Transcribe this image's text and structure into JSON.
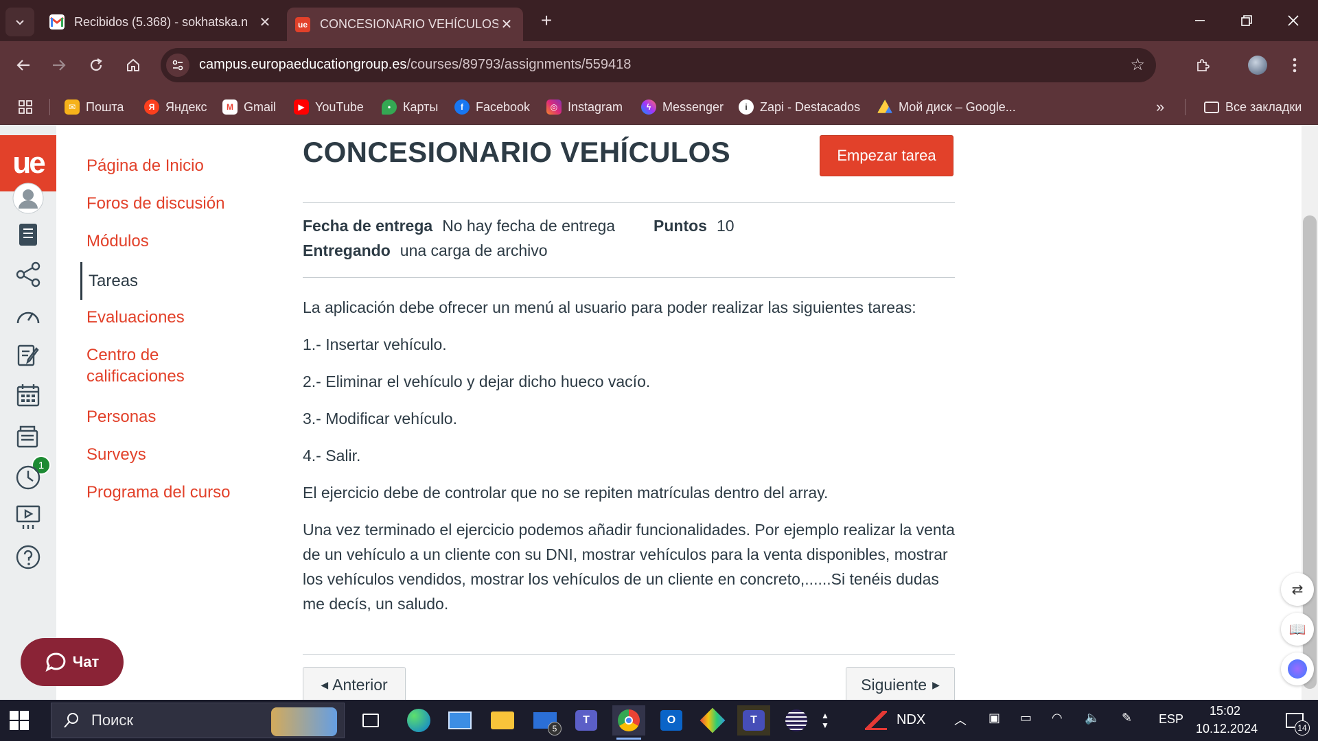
{
  "browser": {
    "tabs": [
      {
        "title": "Recibidos (5.368) - sokhatska.n",
        "favicon": "gmail-icon",
        "active": false
      },
      {
        "title": "CONCESIONARIO VEHÍCULOS",
        "favicon": "ue-icon",
        "active": true
      }
    ],
    "url_host": "campus.europaeducationgroup.es",
    "url_path": "/courses/89793/assignments/559418",
    "bookmarks": [
      {
        "label": "Пошта"
      },
      {
        "label": "Яндекс"
      },
      {
        "label": "Gmail"
      },
      {
        "label": "YouTube"
      },
      {
        "label": "Карты"
      },
      {
        "label": "Facebook"
      },
      {
        "label": "Instagram"
      },
      {
        "label": "Messenger"
      },
      {
        "label": "Zapi - Destacados"
      },
      {
        "label": "Мой диск – Google..."
      }
    ],
    "all_bookmarks_label": "Все закладки",
    "colors": {
      "frame": "#3a2024",
      "toolbar": "#5c3439"
    }
  },
  "global_nav": {
    "logo_text": "ue",
    "badge_count": "1"
  },
  "course_nav": {
    "items": [
      {
        "label": "Página de Inicio",
        "active": false
      },
      {
        "label": "Foros de discusión",
        "active": false
      },
      {
        "label": "Módulos",
        "active": false
      },
      {
        "label": "Tareas",
        "active": true
      },
      {
        "label": "Evaluaciones",
        "active": false
      },
      {
        "label": "Centro de calificaciones",
        "active": false
      },
      {
        "label": "Personas",
        "active": false
      },
      {
        "label": "Surveys",
        "active": false
      },
      {
        "label": "Programa del curso",
        "active": false
      }
    ]
  },
  "assignment": {
    "title": "CONCESIONARIO VEHÍCULOS",
    "start_button": "Empezar tarea",
    "due_label": "Fecha de entrega",
    "due_value": "No hay fecha de entrega",
    "points_label": "Puntos",
    "points_value": "10",
    "submitting_label": "Entregando",
    "submitting_value": "una carga de archivo",
    "description": [
      "La aplicación debe ofrecer un menú al usuario para poder realizar las siguientes tareas:",
      "1.- Insertar vehículo.",
      "2.- Eliminar el vehículo y dejar dicho hueco vacío.",
      "3.- Modificar vehículo.",
      "4.- Salir.",
      "El ejercicio debe de controlar que no se repiten matrículas dentro del array.",
      "Una vez terminado el ejercicio podemos añadir funcionalidades. Por ejemplo realizar la venta de un  vehículo a un cliente con su DNI, mostrar vehículos para la venta disponibles, mostrar los vehículos vendidos, mostrar los vehículos de un cliente en concreto,......Si tenéis dudas me decís, un saludo."
    ],
    "prev_button": "Anterior",
    "next_button": "Siguiente"
  },
  "chat": {
    "label": "Чат"
  },
  "taskbar": {
    "search_placeholder": "Поиск",
    "mail_badge": "5",
    "ndx_label": "NDX",
    "language": "ESP",
    "time": "15:02",
    "date": "10.12.2024",
    "notifications": "14"
  },
  "accent_color": "#e2412a"
}
